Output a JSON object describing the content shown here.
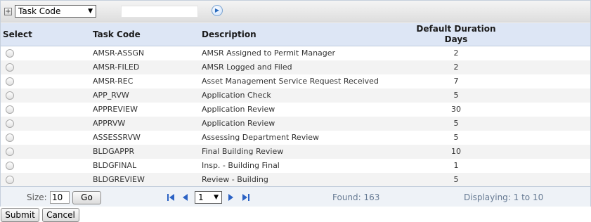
{
  "filter": {
    "field": "Task Code",
    "value": "",
    "expand_icon": "plus-square-icon",
    "go_icon": "arrow-right-circle-icon"
  },
  "columns": {
    "select": "Select",
    "task_code": "Task Code",
    "description": "Description",
    "default_duration_line1": "Default Duration",
    "default_duration_line2": "Days"
  },
  "rows": [
    {
      "task_code": "AMSR-ASSGN",
      "description": "AMSR Assigned to Permit Manager",
      "days": "2"
    },
    {
      "task_code": "AMSR-FILED",
      "description": "AMSR Logged and Filed",
      "days": "2"
    },
    {
      "task_code": "AMSR-REC",
      "description": "Asset Management Service Request Received",
      "days": "7"
    },
    {
      "task_code": "APP_RVW",
      "description": "Application Check",
      "days": "5"
    },
    {
      "task_code": "APPREVIEW",
      "description": "Application Review",
      "days": "30"
    },
    {
      "task_code": "APPRVW",
      "description": "Application Review",
      "days": "5"
    },
    {
      "task_code": "ASSESSRVW",
      "description": "Assessing Department Review",
      "days": "5"
    },
    {
      "task_code": "BLDGAPPR",
      "description": "Final Building Review",
      "days": "10"
    },
    {
      "task_code": "BLDGFINAL",
      "description": "Insp. - Building Final",
      "days": "1"
    },
    {
      "task_code": "BLDGREVIEW",
      "description": "Review - Building",
      "days": "5"
    }
  ],
  "pager": {
    "size_label": "Size:",
    "size_value": "10",
    "go_label": "Go",
    "page_value": "1",
    "found": "Found: 163",
    "displaying": "Displaying: 1 to 10"
  },
  "actions": {
    "submit": "Submit",
    "cancel": "Cancel"
  }
}
